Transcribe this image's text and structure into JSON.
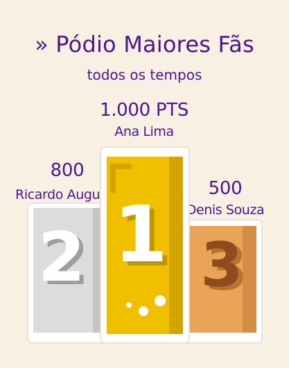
{
  "header": {
    "title": "» Pódio Maiores Fãs",
    "subtitle": "todos os tempos"
  },
  "podium": [
    {
      "rank": "1",
      "score": "1.000 PTS",
      "name": "Ana Lima",
      "color": "#f0bf00"
    },
    {
      "rank": "2",
      "score": "800",
      "name": "Ricardo Augusto",
      "color": "#dcdcdc"
    },
    {
      "rank": "3",
      "score": "500",
      "name": "Denis Souza",
      "color": "#e9a458"
    }
  ]
}
